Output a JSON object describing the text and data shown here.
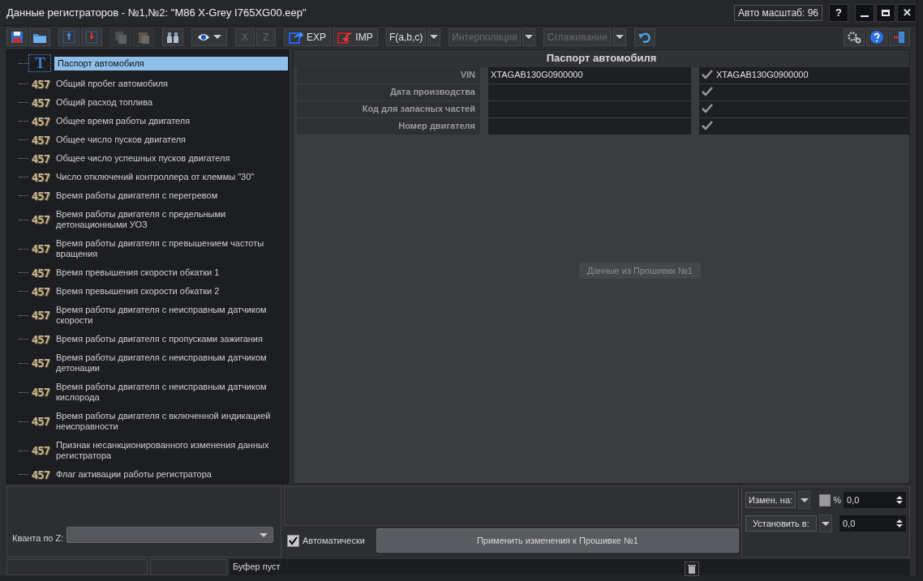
{
  "window": {
    "title": "Данные регистраторов - №1,№2: \"M86 X-Grey I765XG00.eep\"",
    "zoom_label": "Авто масштаб: 96",
    "controls": [
      {
        "kind": "help",
        "label": "?"
      },
      {
        "kind": "minimize"
      },
      {
        "kind": "maximize"
      },
      {
        "kind": "close",
        "label": "✕"
      }
    ]
  },
  "toolbar": [
    {
      "kind": "save",
      "disabled": false
    },
    {
      "kind": "open",
      "disabled": false
    },
    {
      "kind": "sep"
    },
    {
      "kind": "up",
      "disabled": false
    },
    {
      "kind": "down",
      "disabled": false
    },
    {
      "kind": "sep"
    },
    {
      "kind": "copy",
      "disabled": true
    },
    {
      "kind": "paste",
      "disabled": true
    },
    {
      "kind": "sep"
    },
    {
      "kind": "binoculars",
      "disabled": false
    },
    {
      "kind": "sep"
    },
    {
      "kind": "eye",
      "disabled": false
    },
    {
      "kind": "sep"
    },
    {
      "kind": "text",
      "label": "X",
      "disabled": true
    },
    {
      "kind": "text",
      "label": "Z",
      "disabled": true
    },
    {
      "kind": "sep"
    },
    {
      "kind": "export",
      "label": "EXP",
      "disabled": false
    },
    {
      "kind": "import",
      "label": "IMP",
      "disabled": false
    },
    {
      "kind": "sep"
    },
    {
      "kind": "dropdown",
      "label": "F(a,b,c)",
      "disabled": false
    },
    {
      "kind": "sep"
    },
    {
      "kind": "dropdown",
      "label": "Интерполяция",
      "disabled": true
    },
    {
      "kind": "sep"
    },
    {
      "kind": "dropdown",
      "label": "Сглаживание",
      "disabled": true
    },
    {
      "kind": "sep"
    },
    {
      "kind": "undo",
      "disabled": false
    },
    {
      "kind": "spacer"
    },
    {
      "kind": "gear",
      "disabled": false
    },
    {
      "kind": "help",
      "disabled": false
    },
    {
      "kind": "exit",
      "disabled": false
    }
  ],
  "tree": [
    {
      "kind": "text",
      "icon": "T",
      "label": "Паспорт автомобиля",
      "selected": true
    },
    {
      "kind": "number",
      "icon": "457",
      "label": "Общий пробег автомобиля",
      "selected": false
    },
    {
      "kind": "number",
      "icon": "457",
      "label": "Общий расход топлива",
      "selected": false
    },
    {
      "kind": "number",
      "icon": "457",
      "label": "Общее время работы двигателя",
      "selected": false
    },
    {
      "kind": "number",
      "icon": "457",
      "label": "Общее число пусков двигателя",
      "selected": false
    },
    {
      "kind": "number",
      "icon": "457",
      "label": "Общее число успешных пусков двигателя",
      "selected": false
    },
    {
      "kind": "number",
      "icon": "457",
      "label": "Число отключений контроллера от клеммы \"30\"",
      "selected": false
    },
    {
      "kind": "number",
      "icon": "457",
      "label": "Время работы двигателя с перегревом",
      "selected": false
    },
    {
      "kind": "number",
      "icon": "457",
      "label": "Время работы двигателя с предельными детонационными УОЗ",
      "selected": false
    },
    {
      "kind": "number",
      "icon": "457",
      "label": "Время работы двигателя с превышением частоты вращения",
      "selected": false
    },
    {
      "kind": "number",
      "icon": "457",
      "label": "Время превышения скорости обкатки 1",
      "selected": false
    },
    {
      "kind": "number",
      "icon": "457",
      "label": "Время превышения скорости обкатки 2",
      "selected": false
    },
    {
      "kind": "number",
      "icon": "457",
      "label": "Время работы двигателя с неисправным датчиком скорости",
      "selected": false
    },
    {
      "kind": "number",
      "icon": "457",
      "label": "Время работы двигателя с пропусками зажигания",
      "selected": false
    },
    {
      "kind": "number",
      "icon": "457",
      "label": "Время работы двигателя с неисправным датчиком детонации",
      "selected": false
    },
    {
      "kind": "number",
      "icon": "457",
      "label": "Время работы двигателя с неисправным датчиком кислорода",
      "selected": false
    },
    {
      "kind": "number",
      "icon": "457",
      "label": "Время работы двигателя с включенной индикацией неисправности",
      "selected": false
    },
    {
      "kind": "number",
      "icon": "457",
      "label": "Признак несанкционированного изменения данных регистратора",
      "selected": false
    },
    {
      "kind": "number",
      "icon": "457",
      "label": "Флаг активации работы регистратора",
      "selected": false
    }
  ],
  "detail": {
    "title": "Паспорт автомобиля",
    "rows": [
      {
        "label": "VIN",
        "value": "XTAGAB130G0900000",
        "checked": true,
        "compare_value": "XTAGAB130G0900000"
      },
      {
        "label": "Дата производства",
        "checked": true
      },
      {
        "label": "Код для запасных частей",
        "checked": true
      },
      {
        "label": "Номер двигателя",
        "checked": true
      }
    ],
    "tooltip": "Данные из Прошивки №1"
  },
  "bottom": {
    "quant_label": "Кванта по Z:",
    "auto_label": "Автоматически",
    "auto_checked": true,
    "apply_button": "Применить изменения к Прошивке №1",
    "change_by": "Измен. на:",
    "percent_checked": false,
    "percent_label": "%",
    "change_value": "0,0",
    "set_to": "Установить в:",
    "set_value": "0,0"
  },
  "status_bar": {
    "message": "Буфер пуст"
  }
}
